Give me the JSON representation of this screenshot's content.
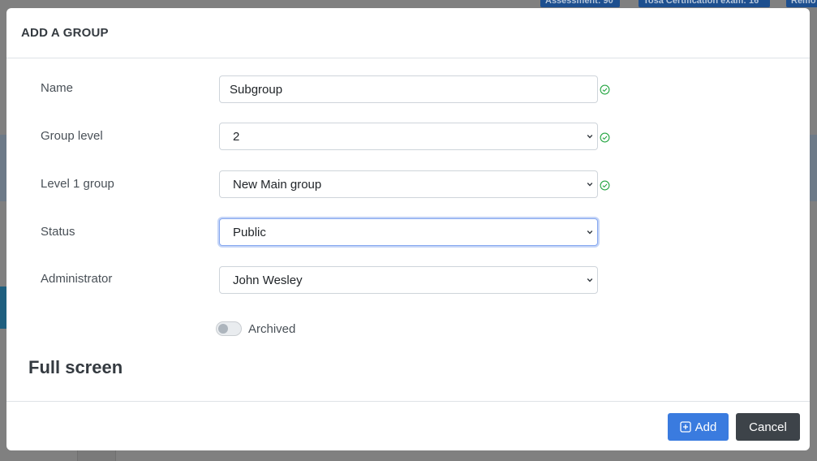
{
  "background": {
    "badges": [
      "Assessment: 90",
      "Tosa Certification exam: 16",
      "Remo"
    ],
    "colors": {
      "overlay": "#808080",
      "badge": "#1d4f8f"
    }
  },
  "modal": {
    "title": "ADD A GROUP",
    "fields": {
      "name": {
        "label": "Name",
        "value": "Subgroup",
        "valid": true
      },
      "group_level": {
        "label": "Group level",
        "value": "2",
        "valid": true
      },
      "level1_group": {
        "label": "Level 1 group",
        "value": "New Main group",
        "valid": true
      },
      "status": {
        "label": "Status",
        "value": "Public",
        "focused": true
      },
      "administrator": {
        "label": "Administrator",
        "value": "John Wesley"
      }
    },
    "archived": {
      "label": "Archived",
      "checked": false
    },
    "section_heading": "Full screen",
    "footer": {
      "add_label": "Add",
      "add_icon": "plus-square-icon",
      "cancel_label": "Cancel"
    }
  },
  "colors": {
    "primary": "#3a7bdf",
    "secondary": "#3d4349",
    "valid": "#28a745",
    "focus": "#86a8f0"
  }
}
